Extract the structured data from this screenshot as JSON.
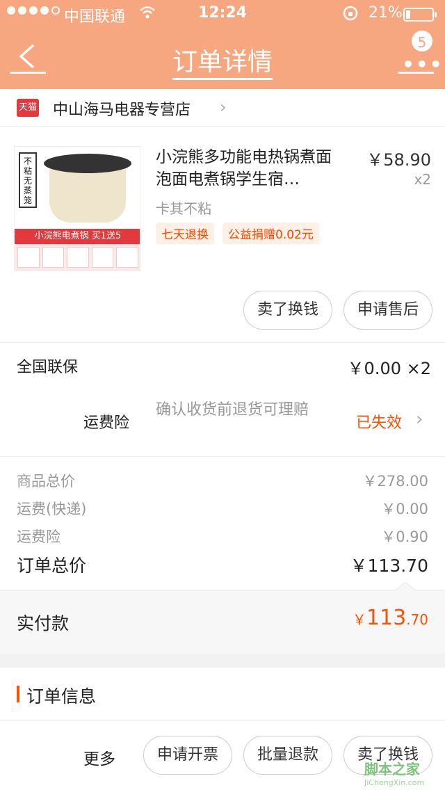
{
  "status": {
    "carrier": "中国联通",
    "time": "12:24",
    "battery": "21%"
  },
  "nav": {
    "title": "订单详情",
    "badge": "5"
  },
  "shop": {
    "name": "中山海马电器专营店",
    "tmall_label": "天猫"
  },
  "product": {
    "title": "小浣熊多功能电热锅煮面泡面电煮锅学生宿…",
    "price": "￥58.90",
    "qty": "x2",
    "sku": "卡其不粘",
    "tags": [
      "七天退换",
      "公益捐赠0.02元"
    ],
    "thumb_side": "不粘无蒸笼",
    "thumb_banner": "小浣熊电煮锅 买1送5"
  },
  "item_buttons": {
    "sell": "卖了换钱",
    "after_sale": "申请售后"
  },
  "warranty": {
    "label": "全国联保",
    "value": "￥0.00 ×2"
  },
  "shipping_ins": {
    "label": "运费险",
    "desc": "确认收货前退货可理赔",
    "status": "已失效"
  },
  "summary": {
    "goods_total_label": "商品总价",
    "goods_total": "￥278.00",
    "freight_label": "运费(快递)",
    "freight": "￥0.00",
    "ins_label": "运费险",
    "ins": "￥0.90",
    "order_total_label": "订单总价",
    "order_total": "￥113.70"
  },
  "paid": {
    "label": "实付款",
    "currency": "￥",
    "int": "113",
    "dec": ".70"
  },
  "order_info": {
    "title": "订单信息"
  },
  "bottom": {
    "more": "更多",
    "invoice": "申请开票",
    "batch_refund": "批量退款",
    "sell": "卖了换钱"
  },
  "watermark": {
    "text": "脚本之家",
    "sub": "JiChengXin.com"
  },
  "colors": {
    "nav_bg": "#f7a77f",
    "accent": "#ff5000"
  }
}
